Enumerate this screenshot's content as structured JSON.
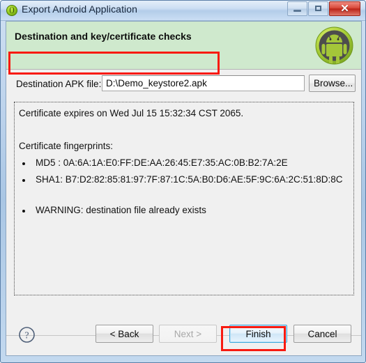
{
  "window": {
    "title": "Export Android Application",
    "app_icon": "export-wizard-icon",
    "controls": {
      "minimize": "minimize-icon",
      "maximize": "maximize-icon",
      "close_glyph": "✕"
    }
  },
  "banner": {
    "title": "Destination and key/certificate checks",
    "logo": "android-robot-icon",
    "background_color": "#cfe9cd"
  },
  "destination": {
    "label": "Destination APK file:",
    "value": "D:\\Demo_keystore2.apk",
    "placeholder": "",
    "browse_label": "Browse...",
    "highlight_color": "#f81a10"
  },
  "certificate": {
    "expiry_line": "Certificate expires on Wed Jul 15 15:32:34 CST 2065.",
    "fingerprints_header": "Certificate fingerprints:",
    "fingerprints": [
      "MD5 : 0A:6A:1A:E0:FF:DE:AA:26:45:E7:35:AC:0B:B2:7A:2E",
      "SHA1: B7:D2:82:85:81:97:7F:87:1C:5A:B0:D6:AE:5F:9C:6A:2C:51:8D:8C"
    ],
    "warning": "WARNING: destination file already exists"
  },
  "footer": {
    "help_icon": "help-question-icon",
    "back_label": "< Back",
    "next_label": "Next >",
    "finish_label": "Finish",
    "cancel_label": "Cancel",
    "finish_highlight_color": "#f81a10",
    "finish_focus_color": "#3aa8dd"
  }
}
